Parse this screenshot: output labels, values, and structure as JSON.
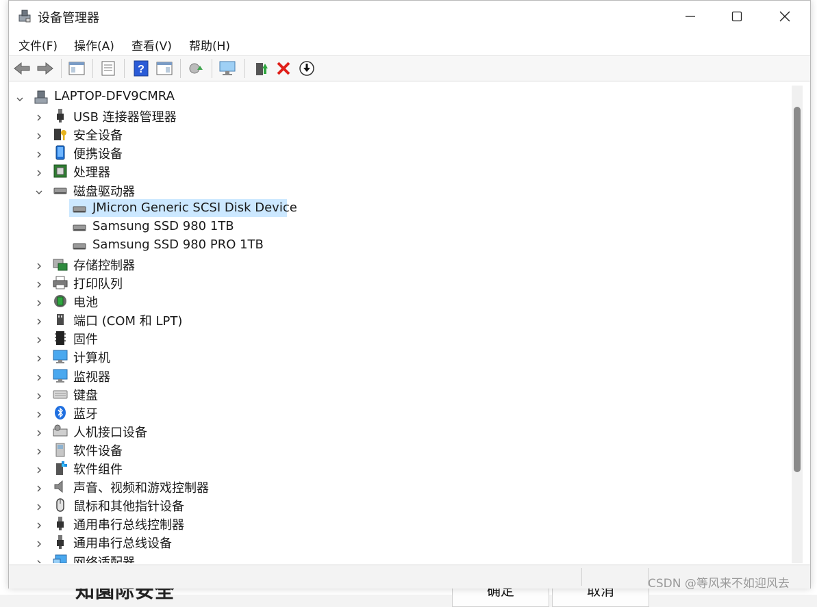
{
  "window": {
    "title": "设备管理器"
  },
  "menu": [
    "文件(F)",
    "操作(A)",
    "查看(V)",
    "帮助(H)"
  ],
  "tree": {
    "root": "LAPTOP-DFV9CMRA",
    "categories": [
      {
        "label": "USB 连接器管理器",
        "icon": "usb-icon",
        "expanded": false
      },
      {
        "label": "安全设备",
        "icon": "security-device-icon",
        "expanded": false
      },
      {
        "label": "便携设备",
        "icon": "portable-device-icon",
        "expanded": false
      },
      {
        "label": "处理器",
        "icon": "processor-icon",
        "expanded": false
      },
      {
        "label": "磁盘驱动器",
        "icon": "disk-drive-icon",
        "expanded": true,
        "children": [
          {
            "label": "JMicron Generic SCSI Disk Device",
            "selected": true
          },
          {
            "label": "Samsung SSD 980 1TB",
            "selected": false
          },
          {
            "label": "Samsung SSD 980 PRO 1TB",
            "selected": false
          }
        ]
      },
      {
        "label": "存储控制器",
        "icon": "storage-controller-icon",
        "expanded": false
      },
      {
        "label": "打印队列",
        "icon": "printer-icon",
        "expanded": false
      },
      {
        "label": "电池",
        "icon": "battery-icon",
        "expanded": false
      },
      {
        "label": "端口 (COM 和 LPT)",
        "icon": "port-icon",
        "expanded": false
      },
      {
        "label": "固件",
        "icon": "firmware-icon",
        "expanded": false
      },
      {
        "label": "计算机",
        "icon": "computer-icon",
        "expanded": false
      },
      {
        "label": "监视器",
        "icon": "monitor-icon",
        "expanded": false
      },
      {
        "label": "键盘",
        "icon": "keyboard-icon",
        "expanded": false
      },
      {
        "label": "蓝牙",
        "icon": "bluetooth-icon",
        "expanded": false
      },
      {
        "label": "人机接口设备",
        "icon": "hid-icon",
        "expanded": false
      },
      {
        "label": "软件设备",
        "icon": "software-device-icon",
        "expanded": false
      },
      {
        "label": "软件组件",
        "icon": "software-component-icon",
        "expanded": false
      },
      {
        "label": "声音、视频和游戏控制器",
        "icon": "speaker-icon",
        "expanded": false
      },
      {
        "label": "鼠标和其他指针设备",
        "icon": "mouse-icon",
        "expanded": false
      },
      {
        "label": "通用串行总线控制器",
        "icon": "usb-controller-icon",
        "expanded": false
      },
      {
        "label": "通用串行总线设备",
        "icon": "usb-device-icon",
        "expanded": false
      },
      {
        "label": "网络适配器",
        "icon": "network-adapter-icon",
        "expanded": false
      }
    ]
  },
  "background": {
    "big_text": "知園际安全",
    "ok_button": "确定",
    "cancel_button": "取消"
  },
  "watermark": "CSDN @等风来不如迎风去",
  "colors": {
    "selection": "#cce8ff",
    "delete_red": "#e0201a",
    "help_blue": "#2a5bd7"
  }
}
